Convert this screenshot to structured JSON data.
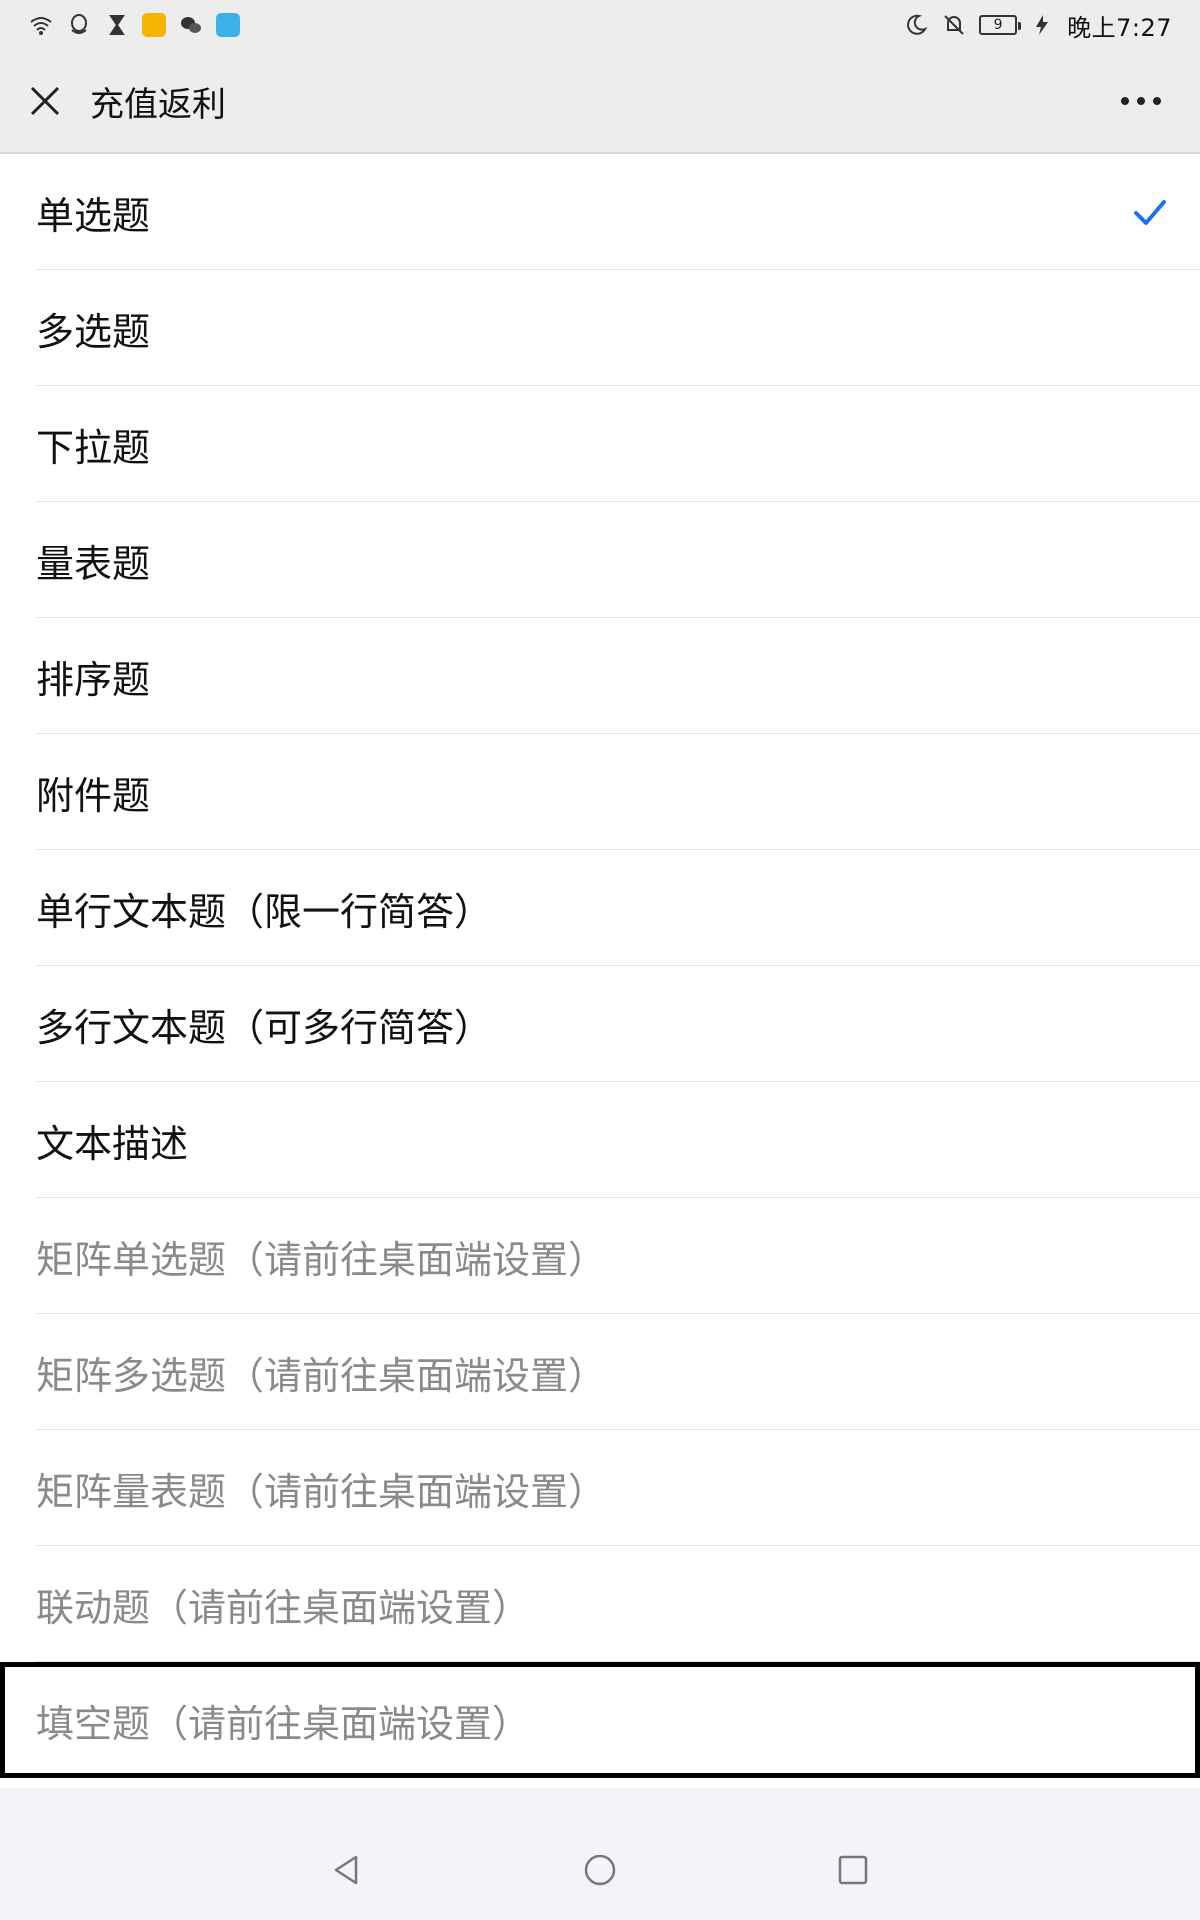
{
  "status_bar": {
    "time": "晚上7:27",
    "battery_level": "9",
    "left_icons": [
      "wifi-icon",
      "qq-icon",
      "hourglass-icon",
      "app-icon",
      "wechat-icon",
      "camera-app-icon"
    ],
    "right_icons": [
      "moon-icon",
      "bell-off-icon",
      "battery-icon",
      "charging-icon"
    ]
  },
  "header": {
    "title": "充值返利",
    "close_icon": "close-icon",
    "more_icon": "more-icon"
  },
  "question_types": {
    "selected_index": 0,
    "items": [
      {
        "label": "单选题",
        "enabled": true
      },
      {
        "label": "多选题",
        "enabled": true
      },
      {
        "label": "下拉题",
        "enabled": true
      },
      {
        "label": "量表题",
        "enabled": true
      },
      {
        "label": "排序题",
        "enabled": true
      },
      {
        "label": "附件题",
        "enabled": true
      },
      {
        "label": "单行文本题（限一行简答）",
        "enabled": true
      },
      {
        "label": "多行文本题（可多行简答）",
        "enabled": true
      },
      {
        "label": "文本描述",
        "enabled": true
      },
      {
        "label": "矩阵单选题（请前往桌面端设置）",
        "enabled": false
      },
      {
        "label": "矩阵多选题（请前往桌面端设置）",
        "enabled": false
      },
      {
        "label": "矩阵量表题（请前往桌面端设置）",
        "enabled": false
      },
      {
        "label": "联动题（请前往桌面端设置）",
        "enabled": false
      },
      {
        "label": "填空题（请前往桌面端设置）",
        "enabled": false
      }
    ]
  },
  "colors": {
    "accent": "#1a73e8",
    "disabled_text": "#8a8a8a",
    "header_bg": "#ededed"
  },
  "nav_bar": {
    "icons": [
      "back-triangle-icon",
      "home-circle-icon",
      "recents-square-icon"
    ]
  }
}
